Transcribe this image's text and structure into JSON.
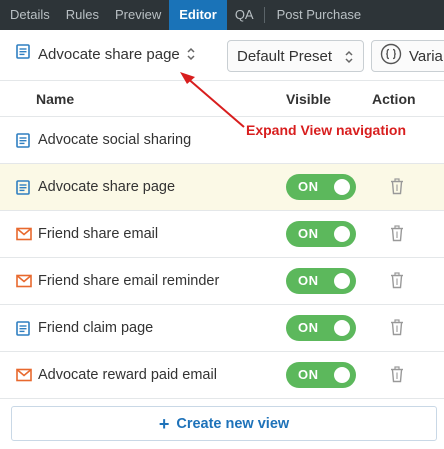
{
  "tabs": [
    {
      "label": "Details",
      "active": false
    },
    {
      "label": "Rules",
      "active": false
    },
    {
      "label": "Preview",
      "active": false
    },
    {
      "label": "Editor",
      "active": true
    },
    {
      "label": "QA",
      "active": false
    },
    {
      "label": "Post Purchase",
      "active": false
    }
  ],
  "toolbar": {
    "view_selector": {
      "label": "Advocate share page",
      "icon": "page-icon"
    },
    "preset_selector": {
      "label": "Default Preset"
    },
    "variables_button": {
      "label": "Varia",
      "icon": "braces-icon"
    }
  },
  "annotation": {
    "text": "Expand View navigation",
    "color": "#d81e1e"
  },
  "table": {
    "headers": {
      "name": "Name",
      "visible": "Visible",
      "action": "Action"
    },
    "rows": [
      {
        "name": "Advocate social sharing",
        "type": "page",
        "visible": null,
        "selected": false
      },
      {
        "name": "Advocate share page",
        "type": "page",
        "visible": "ON",
        "selected": true
      },
      {
        "name": "Friend share email",
        "type": "email",
        "visible": "ON",
        "selected": false
      },
      {
        "name": "Friend share email reminder",
        "type": "email",
        "visible": "ON",
        "selected": false
      },
      {
        "name": "Friend claim page",
        "type": "page",
        "visible": "ON",
        "selected": false
      },
      {
        "name": "Advocate reward paid email",
        "type": "email",
        "visible": "ON",
        "selected": false
      }
    ]
  },
  "create_button": {
    "plus": "+",
    "label": "Create new view"
  },
  "colors": {
    "tabbar_bg": "#2d3438",
    "tab_active_bg": "#1a73b8",
    "toggle_on": "#5cb85c",
    "page_icon": "#2f7fc1",
    "email_icon": "#e8692e",
    "selected_row_bg": "#fbf9e6",
    "link_blue": "#1e72b9"
  }
}
